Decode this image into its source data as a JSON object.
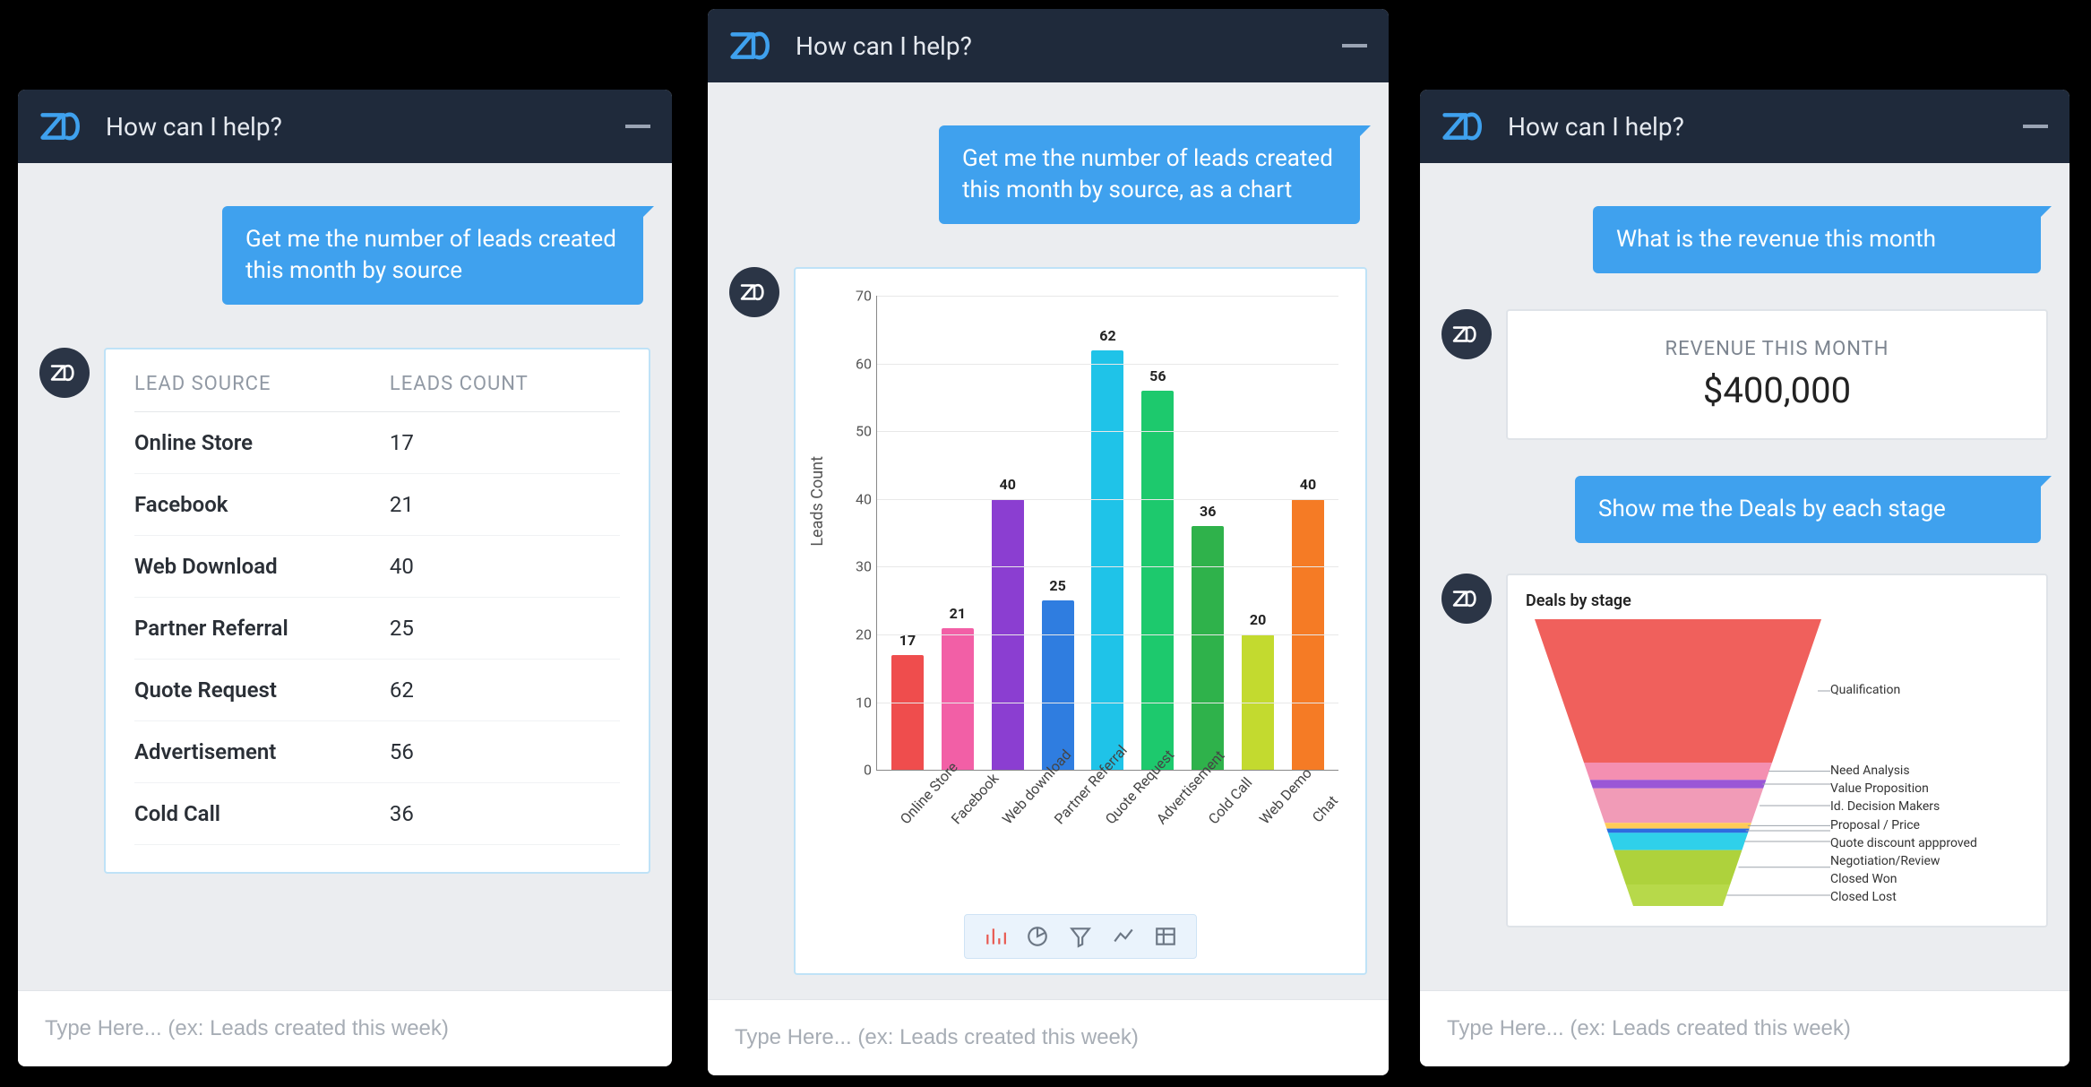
{
  "common": {
    "header_title": "How can I help?",
    "input_placeholder": "Type Here... (ex: Leads created this week)"
  },
  "panel1": {
    "user_msg": "Get me the number of leads created this month by source",
    "table": {
      "col1": "LEAD SOURCE",
      "col2": "LEADS COUNT",
      "rows": [
        {
          "source": "Online Store",
          "count": "17"
        },
        {
          "source": "Facebook",
          "count": "21"
        },
        {
          "source": "Web Download",
          "count": "40"
        },
        {
          "source": "Partner Referral",
          "count": "25"
        },
        {
          "source": "Quote Request",
          "count": "62"
        },
        {
          "source": "Advertisement",
          "count": "56"
        },
        {
          "source": "Cold Call",
          "count": "36"
        }
      ]
    }
  },
  "panel2": {
    "user_msg": "Get me the number of leads created this month by source, as a chart",
    "ylabel": "Leads Count",
    "yticks": [
      "0",
      "10",
      "20",
      "30",
      "40",
      "50",
      "60",
      "70"
    ]
  },
  "panel3": {
    "user_msg1": "What is the revenue this month",
    "metric": {
      "title": "REVENUE THIS MONTH",
      "value": "$400,000"
    },
    "user_msg2": "Show me the Deals by each stage",
    "funnel_title": "Deals by stage",
    "funnel_legend": [
      "Qualification",
      "Need Analysis",
      "Value Proposition",
      "Id. Decision Makers",
      "Proposal / Price",
      "Quote discount appproved",
      "Negotiation/Review",
      "Closed Won",
      "Closed Lost"
    ]
  },
  "chart_data": [
    {
      "type": "bar",
      "title": "",
      "xlabel": "",
      "ylabel": "Leads Count",
      "ylim": [
        0,
        70
      ],
      "categories": [
        "Online Store",
        "Facebook",
        "Web download",
        "Partner Referral",
        "Quote Request",
        "Advertisement",
        "Cold Call",
        "Web Demo",
        "Chat"
      ],
      "values": [
        17,
        21,
        40,
        25,
        62,
        56,
        36,
        20,
        40
      ],
      "colors": [
        "#ef4d4d",
        "#f25fa6",
        "#8b3ed1",
        "#2f7de0",
        "#1fc3e8",
        "#1dc96d",
        "#2fb24b",
        "#c3da2f",
        "#f57b25"
      ]
    },
    {
      "type": "funnel",
      "title": "Deals by stage",
      "stages": [
        {
          "name": "Qualification",
          "share": 0.5,
          "color": "#f0605c"
        },
        {
          "name": "Need Analysis",
          "share": 0.06,
          "color": "#f48fb1"
        },
        {
          "name": "Value Proposition",
          "share": 0.03,
          "color": "#9a57d6"
        },
        {
          "name": "Id. Decision Makers",
          "share": 0.12,
          "color": "#f19bb7"
        },
        {
          "name": "Proposal / Price",
          "share": 0.02,
          "color": "#ffcb57"
        },
        {
          "name": "Quote discount appproved",
          "share": 0.015,
          "color": "#2d6be0"
        },
        {
          "name": "Negotiation/Review",
          "share": 0.06,
          "color": "#2fd0ea"
        },
        {
          "name": "Closed Won",
          "share": 0.12,
          "color": "#aed23c"
        },
        {
          "name": "Closed Lost",
          "share": 0.075,
          "color": "#b7d94a"
        }
      ]
    }
  ]
}
